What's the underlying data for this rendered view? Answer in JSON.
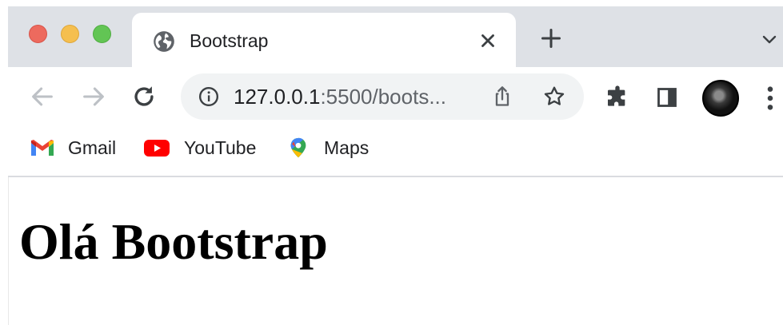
{
  "window": {
    "controls": [
      "close",
      "minimize",
      "zoom"
    ]
  },
  "tab": {
    "title": "Bootstrap",
    "favicon": "globe-icon",
    "close_icon": "close-icon"
  },
  "tabstrip": {
    "new_tab_icon": "plus-icon",
    "tab_search_icon": "chevron-down-icon"
  },
  "toolbar": {
    "back_icon": "arrow-left-icon",
    "forward_icon": "arrow-right-icon",
    "reload_icon": "reload-icon",
    "extensions_icon": "puzzle-icon",
    "side_panel_icon": "side-panel-icon",
    "menu_icon": "more-vert-icon"
  },
  "omnibox": {
    "url_host": "127.0.0.1",
    "url_rest": ":5500/boots...",
    "info_icon": "info-icon",
    "share_icon": "share-icon",
    "bookmark_icon": "star-icon"
  },
  "bookmarks": [
    {
      "label": "Gmail",
      "icon": "gmail-icon"
    },
    {
      "label": "YouTube",
      "icon": "youtube-icon"
    },
    {
      "label": "Maps",
      "icon": "maps-icon"
    }
  ],
  "page": {
    "heading": "Olá Bootstrap"
  },
  "colors": {
    "tabstrip_bg": "#dee1e6",
    "omnibox_bg": "#f1f3f4",
    "close_red": "#ed6a5e",
    "minimize_yellow": "#f5bf4f",
    "zoom_green": "#62c554"
  }
}
